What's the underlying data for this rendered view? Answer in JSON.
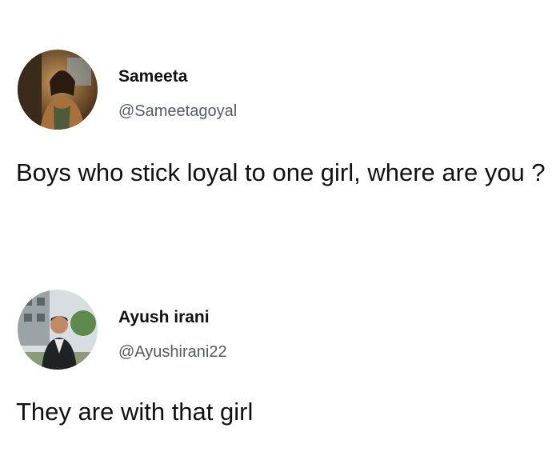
{
  "posts": [
    {
      "display_name": "Sameeta",
      "handle": "@Sameetagoyal",
      "text": "Boys who stick loyal to one girl, where are you ?",
      "avatar": "profile-photo"
    },
    {
      "display_name": "Ayush irani",
      "handle": "@Ayushirani22",
      "text": "They are with that girl",
      "avatar": "profile-photo"
    }
  ],
  "colors": {
    "text_primary": "#111111",
    "text_secondary": "#555c61",
    "background": "#ffffff"
  }
}
